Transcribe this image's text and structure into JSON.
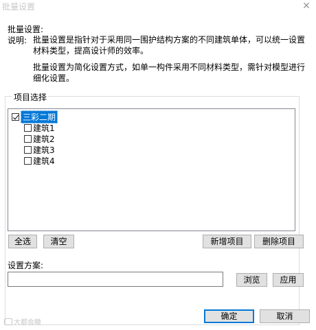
{
  "window": {
    "title": "批量设置",
    "close_glyph": "✕"
  },
  "header": {
    "heading": "批量设置:",
    "desc_label": "说明:",
    "desc_line1": "批量设置是指针对于采用同一围护结构方案的不同建筑单体，可以统一设置材料类型，提高设计师的效率。",
    "desc_line2": "批量设置为简化设置方式，如单一构件采用不同材料类型，需针对模型进行细化设置。"
  },
  "project_group": {
    "label": "项目选择",
    "tree": {
      "root": {
        "label": "三彩二期",
        "checked": true
      },
      "children": [
        {
          "label": "建筑1",
          "checked": false
        },
        {
          "label": "建筑2",
          "checked": false
        },
        {
          "label": "建筑3",
          "checked": false
        },
        {
          "label": "建筑4",
          "checked": false
        }
      ]
    },
    "buttons": {
      "select_all": "全选",
      "clear": "清空",
      "add_project": "新增项目",
      "delete_project": "删除项目"
    }
  },
  "scheme": {
    "label": "设置方案:",
    "value": "",
    "browse": "浏览",
    "apply": "应用"
  },
  "footer": {
    "ok": "确定",
    "cancel": "取消"
  },
  "watermark": {
    "text": "大都会瞰"
  }
}
